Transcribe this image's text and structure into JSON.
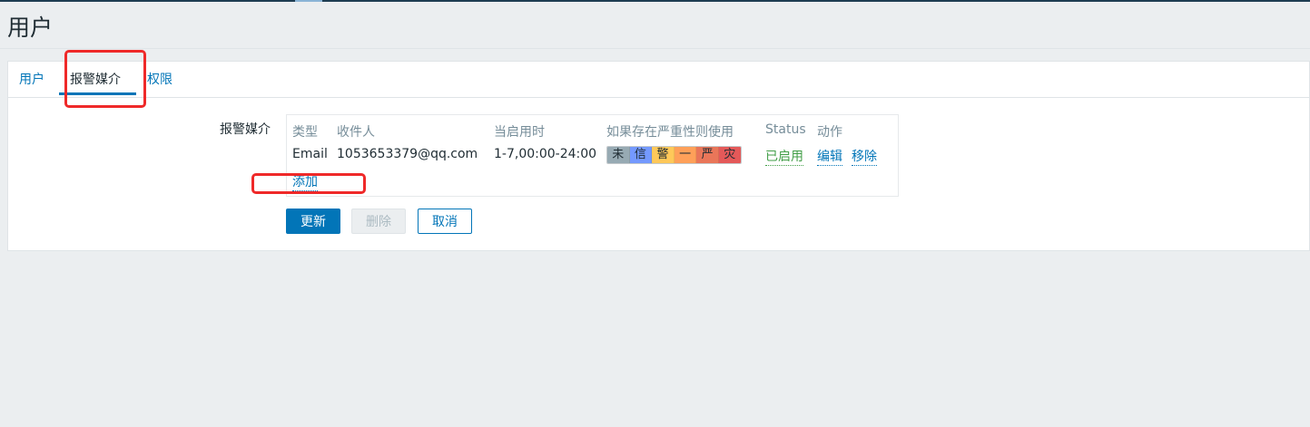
{
  "page": {
    "title": "用户"
  },
  "tabs": [
    {
      "label": "用户",
      "active": false
    },
    {
      "label": "报警媒介",
      "active": true
    },
    {
      "label": "权限",
      "active": false
    }
  ],
  "media": {
    "label": "报警媒介",
    "columns": {
      "type": "类型",
      "recipient": "收件人",
      "when_active": "当启用时",
      "severity": "如果存在严重性则使用",
      "status": "Status",
      "action": "动作"
    },
    "rows": [
      {
        "type": "Email",
        "recipient": "1053653379@qq.com",
        "when_active": "1-7,00:00-24:00",
        "severities": [
          {
            "label": "未",
            "color": "#97aab3"
          },
          {
            "label": "信",
            "color": "#7499ff"
          },
          {
            "label": "警",
            "color": "#ffc859"
          },
          {
            "label": "一",
            "color": "#ffa059"
          },
          {
            "label": "严",
            "color": "#e97659"
          },
          {
            "label": "灾",
            "color": "#e45959"
          }
        ],
        "status": "已启用",
        "edit_label": "编辑",
        "remove_label": "移除"
      }
    ],
    "add_label": "添加"
  },
  "buttons": {
    "update": "更新",
    "delete": "删除",
    "cancel": "取消"
  },
  "colors": {
    "accent": "#0275b8",
    "enabled": "#429e47",
    "annotation": "#ef2929"
  }
}
